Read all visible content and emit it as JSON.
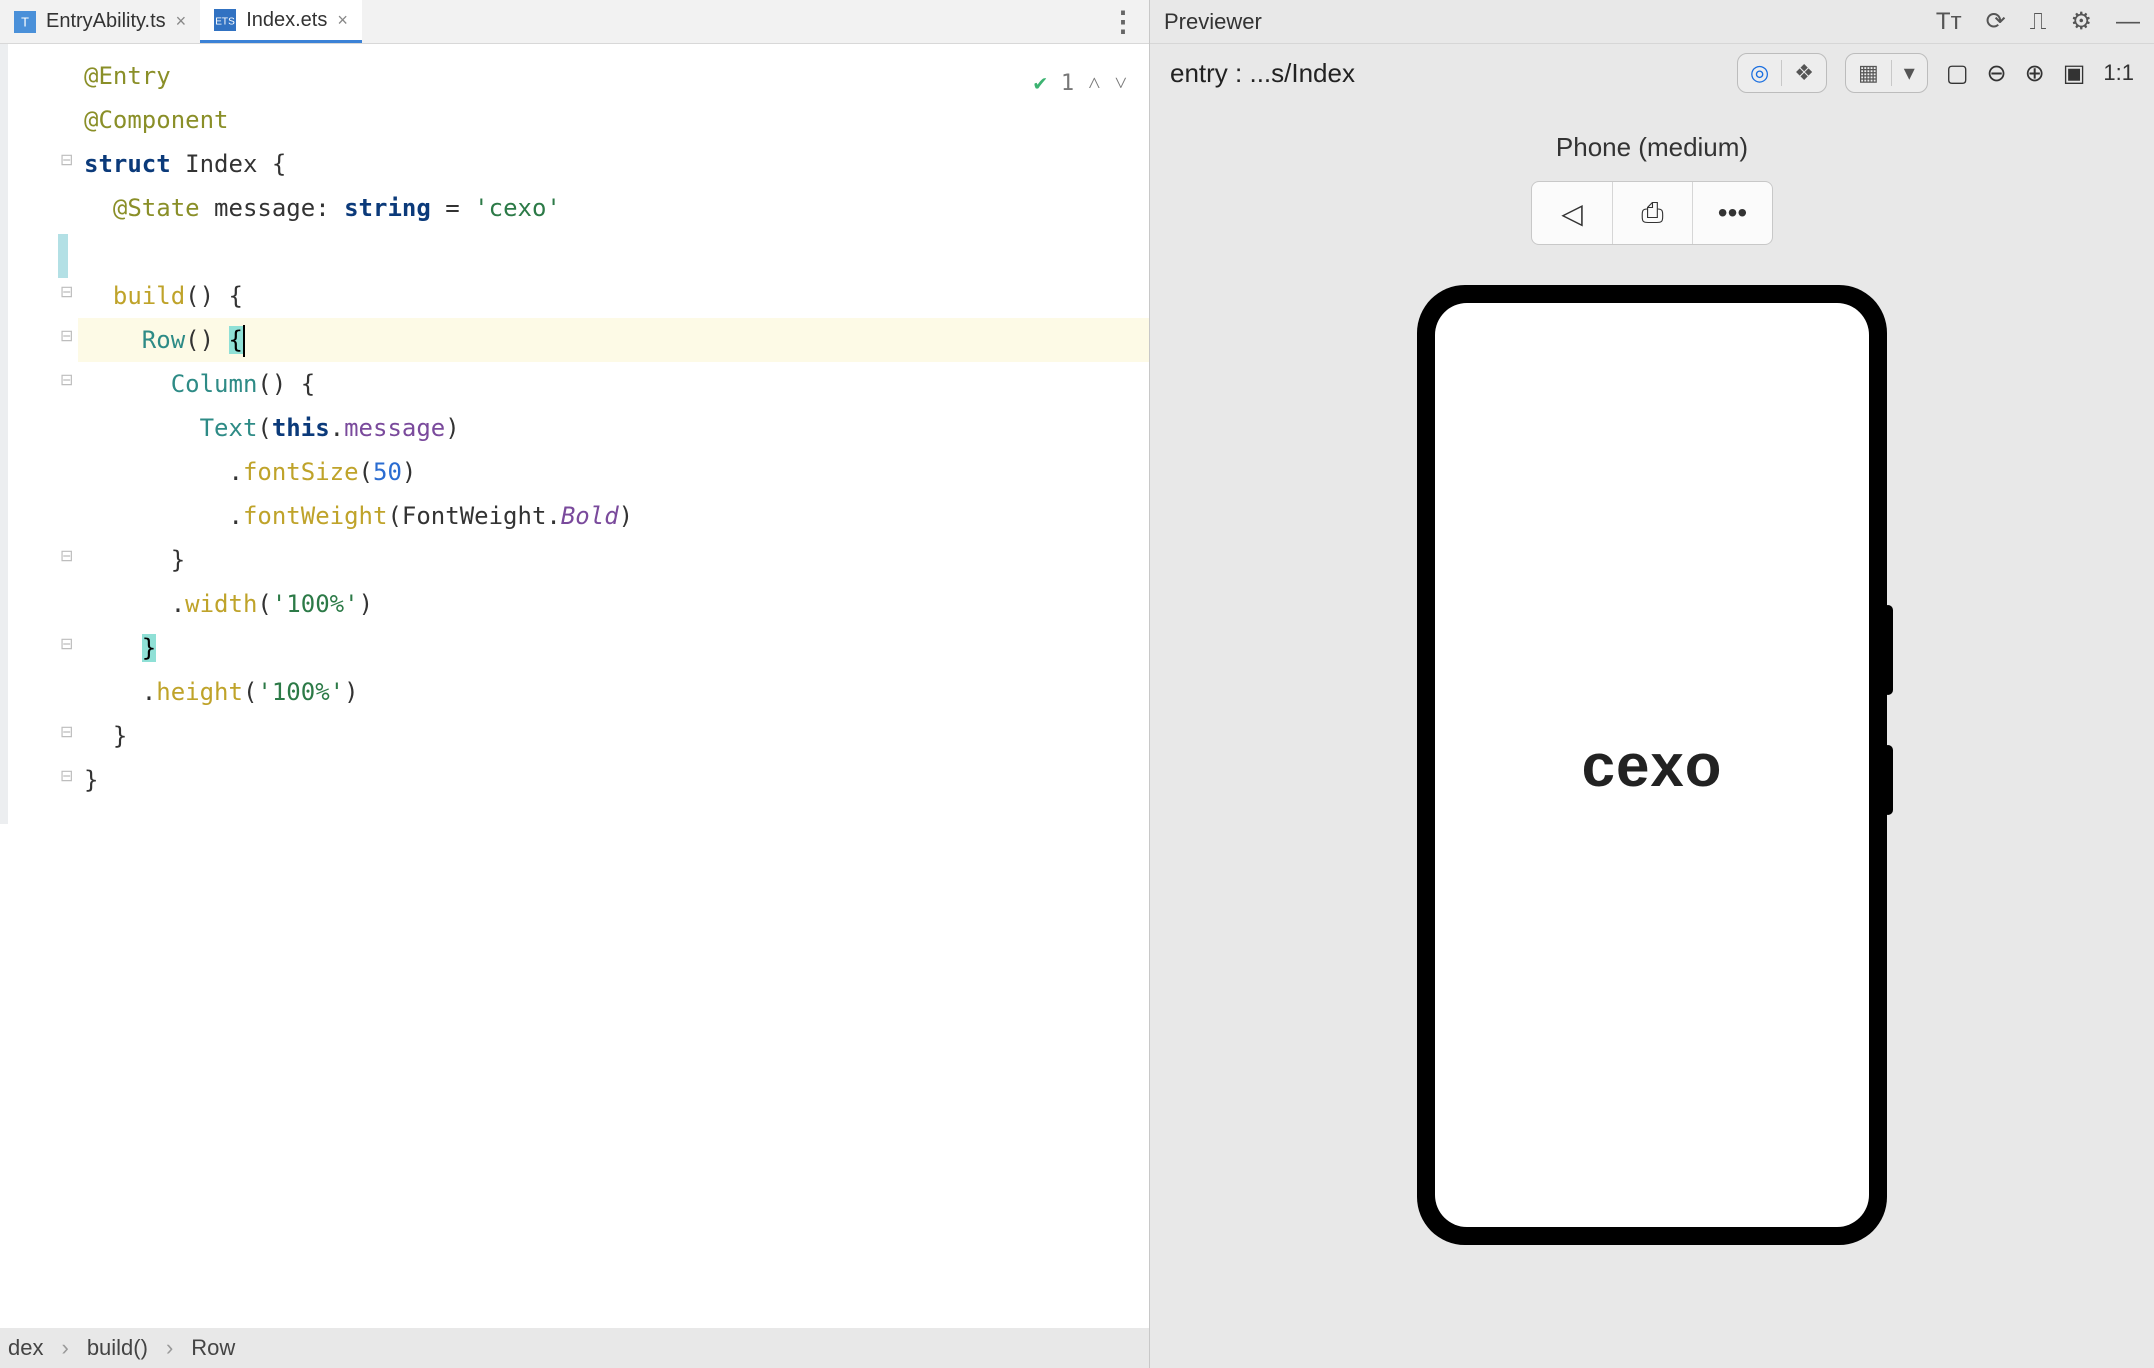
{
  "tabs": [
    {
      "label": "EntryAbility.ts",
      "active": false
    },
    {
      "label": "Index.ets",
      "active": true
    }
  ],
  "code": {
    "decor_entry": "@Entry",
    "decor_component": "@Component",
    "struct_kw": "struct",
    "struct_name": "Index",
    "open_brace": " {",
    "state_decor": "@State",
    "state_var": " message",
    "colon": ":",
    "state_type": " string",
    "eq": " = ",
    "state_val": "'cexo'",
    "build_name": "build",
    "parens": "()",
    "brace_open": " {",
    "row_name": "Row",
    "row_brace": "{",
    "column_name": "Column",
    "col_brace_open": " {",
    "text_name": "Text",
    "this_kw": "this",
    "dot": ".",
    "msg_prop": "message",
    "fontsize_name": "fontSize",
    "fontsize_arg": "50",
    "fontweight_name": "fontWeight",
    "fontweight_enum": "FontWeight",
    "fontweight_val": "Bold",
    "close_brace": "}",
    "width_name": "width",
    "width_arg": "'100%'",
    "height_name": "height",
    "height_arg": "'100%'"
  },
  "hint_count": "1",
  "breadcrumb": [
    "dex",
    "build()",
    "Row"
  ],
  "previewer": {
    "title": "Previewer",
    "entry_label": "entry : ...s/Index",
    "ratio": "1:1",
    "device_label": "Phone (medium)",
    "screen_text": "cexo"
  }
}
